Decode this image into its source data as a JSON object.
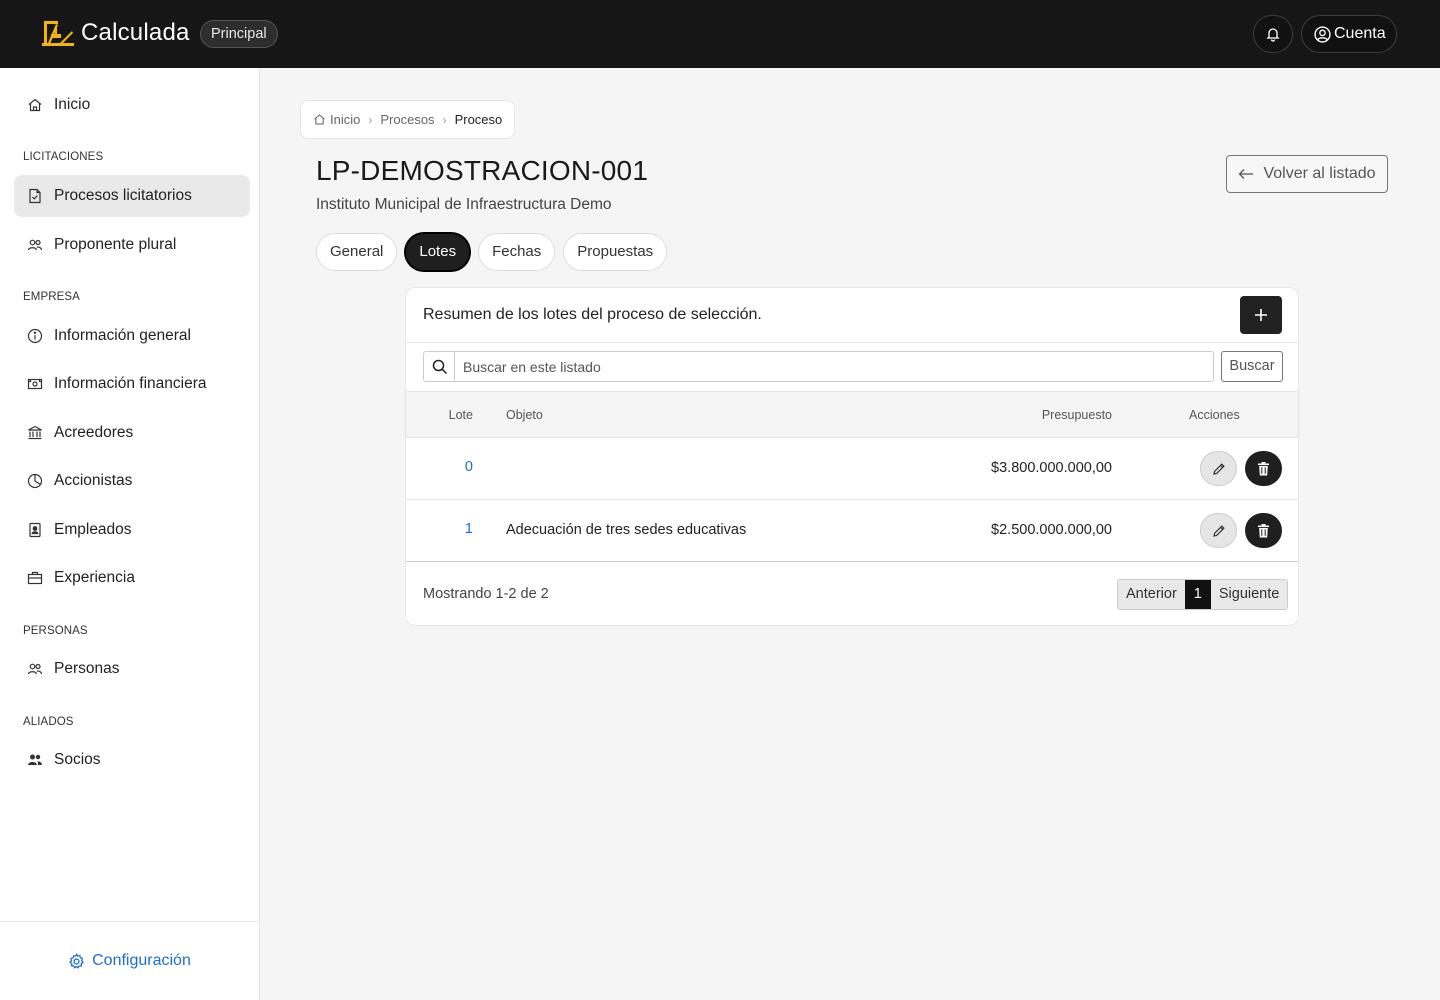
{
  "app": {
    "name": "Calculada",
    "environment": "Principal",
    "account_label": "Cuenta"
  },
  "sidebar": {
    "top_item": "Inicio",
    "sections": {
      "licitaciones": "LICITACIONES",
      "empresa": "EMPRESA",
      "personas": "PERSONAS",
      "aliados": "ALIADOS"
    },
    "items": {
      "procesos": "Procesos licitatorios",
      "proponente": "Proponente plural",
      "info_general": "Información general",
      "info_financiera": "Información financiera",
      "acreedores": "Acreedores",
      "accionistas": "Accionistas",
      "empleados": "Empleados",
      "experiencia": "Experiencia",
      "personas": "Personas",
      "socios": "Socios"
    },
    "active_item": "Procesos licitatorios",
    "settings_label": "Configuración"
  },
  "breadcrumb": {
    "home": "Inicio",
    "level1": "Procesos",
    "current": "Proceso"
  },
  "page": {
    "title": "LP-DEMOSTRACION-001",
    "subtitle": "Instituto Municipal de Infraestructura Demo",
    "back_label": "Volver al listado"
  },
  "tabs": {
    "general": "General",
    "lotes": "Lotes",
    "fechas": "Fechas",
    "propuestas": "Propuestas",
    "active": "Lotes"
  },
  "card": {
    "title": "Resumen de los lotes del proceso de selección.",
    "search_placeholder": "Buscar en este listado",
    "search_button": "Buscar",
    "columns": {
      "lote": "Lote",
      "objeto": "Objeto",
      "presupuesto": "Presupuesto",
      "acciones": "Acciones"
    },
    "rows": [
      {
        "lote": "0",
        "objeto": "",
        "presupuesto": "$3.800.000.000,00"
      },
      {
        "lote": "1",
        "objeto": "Adecuación de tres sedes educativas",
        "presupuesto": "$2.500.000.000,00"
      }
    ],
    "pagination": {
      "info": "Mostrando 1-2 de 2",
      "prev": "Anterior",
      "current_page": "1",
      "next": "Siguiente"
    }
  },
  "colors": {
    "topbar": "#161616",
    "brand_accent": "#f2b705",
    "link_blue": "#1a6fd1",
    "dark_button": "#1f1f1f"
  },
  "icons": [
    "home-icon",
    "document-icon",
    "people-icon",
    "info-icon",
    "cash-icon",
    "bank-icon",
    "pie-icon",
    "badge-icon",
    "briefcase-icon",
    "gear-icon",
    "bell-icon",
    "user-circle-icon",
    "search-icon",
    "plus-icon",
    "pencil-icon",
    "trash-icon",
    "arrow-left-icon",
    "chevron-right-icon"
  ]
}
